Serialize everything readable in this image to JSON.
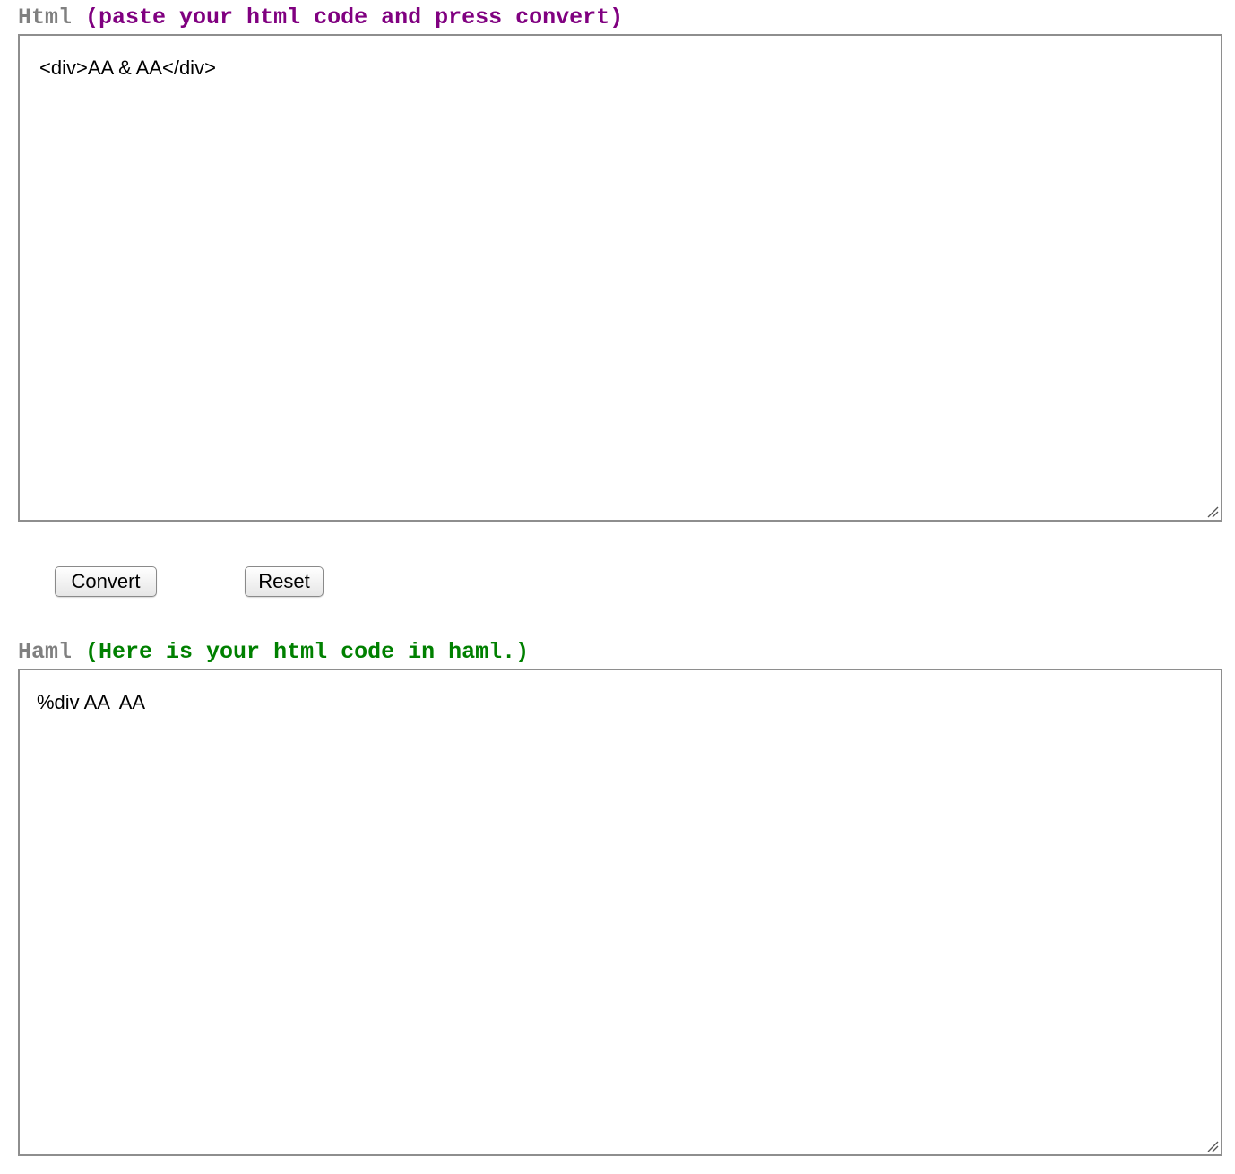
{
  "input_section": {
    "label": "Html",
    "hint": "(paste your html code and press convert)",
    "editor_value": "<div>AA & AA</div>"
  },
  "actions": {
    "convert_label": "Convert",
    "reset_label": "Reset"
  },
  "output_section": {
    "label": "Haml",
    "hint": "(Here is your html code in haml.)",
    "editor_value": "%div AA  AA"
  },
  "colors": {
    "label_gray": "#808080",
    "input_hint": "#800080",
    "output_hint": "#008000"
  }
}
